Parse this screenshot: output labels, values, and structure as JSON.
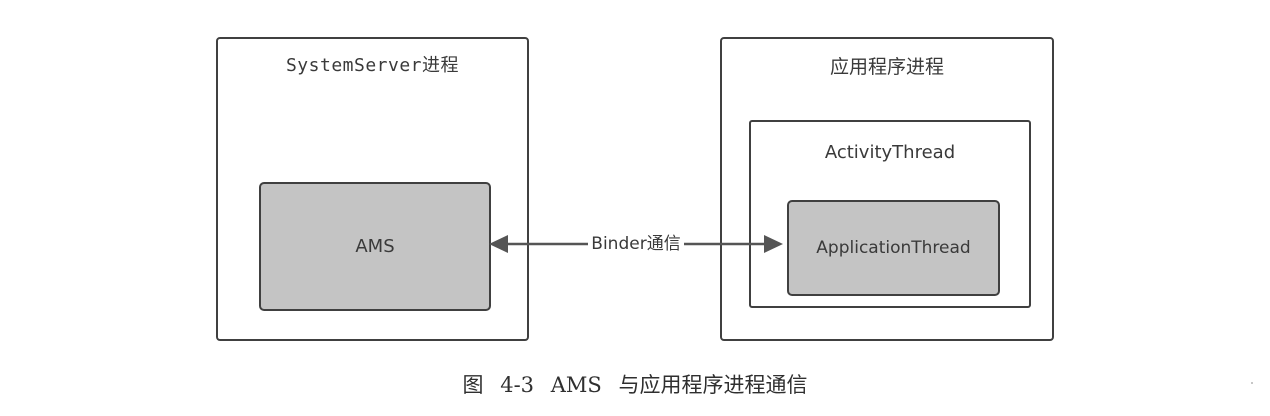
{
  "diagram": {
    "left_process": {
      "title": "SystemServer进程",
      "component": "AMS"
    },
    "right_process": {
      "title": "应用程序进程",
      "container": {
        "title": "ActivityThread",
        "component": "ApplicationThread"
      }
    },
    "connection": {
      "label": "Binder通信",
      "direction": "bidirectional"
    }
  },
  "caption": "图 4-3 AMS 与应用程序进程通信",
  "colors": {
    "border": "#404040",
    "component_fill": "#c4c4c4",
    "arrow": "#555555",
    "text": "#3a3a3a"
  }
}
